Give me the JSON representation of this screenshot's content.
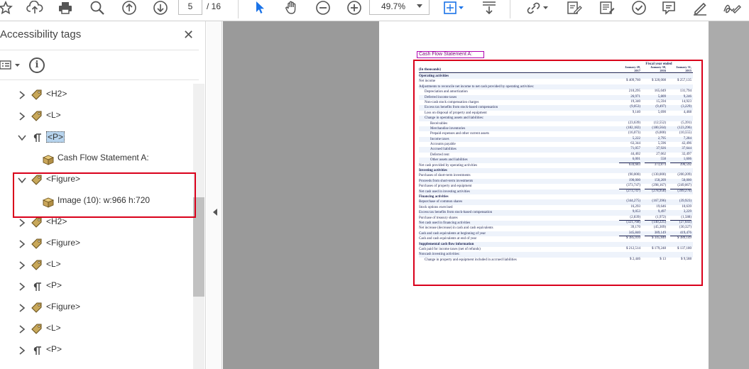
{
  "toolbar": {
    "page_current": "5",
    "page_total": "/ 16",
    "zoom": "49.7%"
  },
  "panel": {
    "title": "Accessibility tags",
    "close": "✕",
    "info": "i",
    "tree": [
      {
        "label": "<H2>",
        "kind": "tag",
        "state": "collapsed",
        "indent": 0
      },
      {
        "label": "<L>",
        "kind": "tag",
        "state": "collapsed",
        "indent": 0
      },
      {
        "label": "<P>",
        "kind": "para",
        "state": "expanded",
        "indent": 0,
        "selected": true
      },
      {
        "label": "Cash Flow Statement A:",
        "kind": "content",
        "state": "none",
        "indent": 1
      },
      {
        "label": "<Figure>",
        "kind": "tag",
        "state": "expanded",
        "indent": 0
      },
      {
        "label": "Image (10): w:966 h:720",
        "kind": "content",
        "state": "none",
        "indent": 1
      },
      {
        "label": "<H2>",
        "kind": "tag",
        "state": "collapsed",
        "indent": 0
      },
      {
        "label": "<Figure>",
        "kind": "tag",
        "state": "collapsed",
        "indent": 0
      },
      {
        "label": "<L>",
        "kind": "tag",
        "state": "collapsed",
        "indent": 0
      },
      {
        "label": "<P>",
        "kind": "para",
        "state": "collapsed",
        "indent": 0
      },
      {
        "label": "<Figure>",
        "kind": "tag",
        "state": "collapsed",
        "indent": 0
      },
      {
        "label": "<L>",
        "kind": "tag",
        "state": "collapsed",
        "indent": 0
      },
      {
        "label": "<P>",
        "kind": "para",
        "state": "collapsed",
        "indent": 0
      }
    ]
  },
  "document": {
    "tag_label": "Cash Flow Statement A:",
    "fs_title": "Fiscal year ended",
    "col_headers": [
      "January 28, 2017",
      "January 30, 2016",
      "January 31, 2015"
    ],
    "unit_label": "(In thousands)",
    "rows": [
      {
        "d": "Operating activities",
        "b": true,
        "i": 0,
        "v": [
          "",
          "",
          ""
        ]
      },
      {
        "d": "Net income",
        "i": 0,
        "v": [
          "$ 409,760",
          "$ 320,008",
          "$ 257,135"
        ]
      },
      {
        "d": "Adjustments to reconcile net income to net cash provided by operating activities:",
        "i": 0,
        "v": [
          "",
          "",
          ""
        ]
      },
      {
        "d": "Depreciation and amortization",
        "i": 1,
        "v": [
          "210,295",
          "165,049",
          "131,794"
        ]
      },
      {
        "d": "Deferred income taxes",
        "i": 1,
        "v": [
          "26,971",
          "5,809",
          "9,246"
        ]
      },
      {
        "d": "Non-cash stock compensation charges",
        "i": 1,
        "v": [
          "19,340",
          "15,594",
          "14,923"
        ]
      },
      {
        "d": "Excess tax benefits from stock-based compensation",
        "i": 1,
        "v": [
          "(9,053)",
          "(9,497)",
          "(3,229)"
        ]
      },
      {
        "d": "Loss on disposal of property and equipment",
        "i": 1,
        "v": [
          "9,140",
          "5,690",
          "4,468"
        ]
      },
      {
        "d": "Change in operating assets and liabilities:",
        "i": 1,
        "v": [
          "",
          "",
          ""
        ]
      },
      {
        "d": "Receivables",
        "i": 2,
        "v": [
          "(23,639)",
          "(12,552)",
          "(5,391)"
        ]
      },
      {
        "d": "Merchandise inventories",
        "i": 2,
        "v": [
          "(182,182)",
          "(180,564)",
          "(123,296)"
        ]
      },
      {
        "d": "Prepaid expenses and other current assets",
        "i": 2,
        "v": [
          "(16,073)",
          "(6,000)",
          "(10,555)"
        ]
      },
      {
        "d": "Income taxes",
        "i": 2,
        "v": [
          "5,222",
          "2,795",
          "7,284"
        ]
      },
      {
        "d": "Accounts payable",
        "i": 2,
        "v": [
          "63,344",
          "5,596",
          "42,496"
        ]
      },
      {
        "d": "Accrued liabilities",
        "i": 2,
        "v": [
          "71,057",
          "37,926",
          "37,644"
        ]
      },
      {
        "d": "Deferred rent",
        "i": 2,
        "v": [
          "44,402",
          "27,662",
          "32,497"
        ]
      },
      {
        "d": "Other assets and liabilities",
        "i": 2,
        "v": [
          "6,001",
          "558",
          "1,606"
        ],
        "u": true
      },
      {
        "d": "Net cash provided by operating activities",
        "i": 0,
        "v": [
          "634,683",
          "373,874",
          "396,592"
        ]
      },
      {
        "d": "Investing activities",
        "b": true,
        "i": 0,
        "v": [
          "",
          "",
          ""
        ]
      },
      {
        "d": "Purchases of short-term investments",
        "i": 0,
        "v": [
          "(90,000)",
          "(130,000)",
          "(200,209)"
        ]
      },
      {
        "d": "Proceeds from short-term investments",
        "i": 0,
        "v": [
          "190,000",
          "150,209",
          "50,000"
        ]
      },
      {
        "d": "Purchases of property and equipment",
        "i": 0,
        "v": [
          "(373,747)",
          "(298,167)",
          "(249,067)"
        ],
        "u": true
      },
      {
        "d": "Net cash used in investing activities",
        "i": 0,
        "v": [
          "(273,747)",
          "(278,958)",
          "(399,276)"
        ]
      },
      {
        "d": "Financing activities",
        "b": true,
        "i": 0,
        "v": [
          "",
          "",
          ""
        ]
      },
      {
        "d": "Repurchase of common shares",
        "i": 0,
        "v": [
          "(344,275)",
          "(167,396)",
          "(39,923)"
        ]
      },
      {
        "d": "Stock options exercised",
        "i": 0,
        "v": [
          "16,293",
          "19,646",
          "10,639"
        ]
      },
      {
        "d": "Excess tax benefits from stock-based compensation",
        "i": 0,
        "v": [
          "9,053",
          "9,497",
          "3,229"
        ]
      },
      {
        "d": "Purchase of treasury shares",
        "i": 0,
        "v": [
          "(2,839)",
          "(1,972)",
          "(1,588)"
        ],
        "u": true
      },
      {
        "d": "Net cash used in financing activities",
        "i": 0,
        "v": [
          "(321,768)",
          "(140,225)",
          "(27,643)"
        ]
      },
      {
        "d": "Net increase (decrease) in cash and cash equivalents",
        "i": 0,
        "v": [
          "39,170",
          "(45,309)",
          "(30,327)"
        ]
      },
      {
        "d": "Cash and cash equivalents at beginning of year",
        "i": 0,
        "v": [
          "345,840",
          "389,149",
          "419,476"
        ],
        "u": true
      },
      {
        "d": "Cash and cash equivalents at end of year",
        "i": 0,
        "v": [
          "$ 385,010",
          "$ 345,840",
          "$ 389,149"
        ]
      },
      {
        "d": "Supplemental cash flow information",
        "b": true,
        "i": 0,
        "v": [
          "",
          "",
          ""
        ]
      },
      {
        "d": "Cash paid for income taxes (net of refunds)",
        "i": 0,
        "v": [
          "$ 212,514",
          "$ 179,248",
          "$ 137,180"
        ]
      },
      {
        "d": "Noncash investing activities:",
        "i": 0,
        "v": [
          "",
          "",
          ""
        ]
      },
      {
        "d": "Change in property and equipment included in accrued liabilities",
        "i": 1,
        "v": [
          "$ 2,446",
          "$ 13",
          "$ 9,588"
        ]
      }
    ]
  },
  "colors": {
    "highlight_red": "#d9001b",
    "tag_magenta": "#b000b0",
    "selection_blue": "#b7d4ee",
    "viewer_bg": "#9a9a9a"
  }
}
